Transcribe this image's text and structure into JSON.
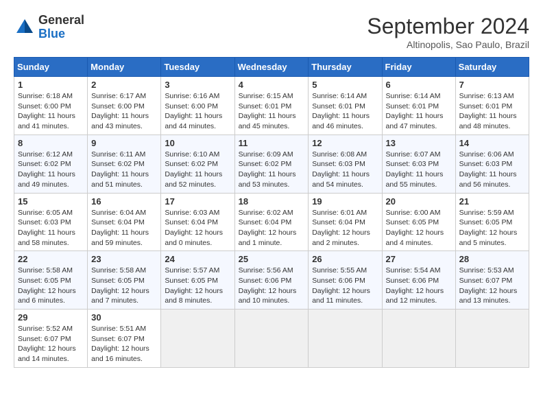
{
  "header": {
    "logo_line1": "General",
    "logo_line2": "Blue",
    "month": "September 2024",
    "location": "Altinopolis, Sao Paulo, Brazil"
  },
  "days_of_week": [
    "Sunday",
    "Monday",
    "Tuesday",
    "Wednesday",
    "Thursday",
    "Friday",
    "Saturday"
  ],
  "weeks": [
    [
      {
        "day": "1",
        "sunrise": "6:18 AM",
        "sunset": "6:00 PM",
        "daylight": "11 hours and 41 minutes."
      },
      {
        "day": "2",
        "sunrise": "6:17 AM",
        "sunset": "6:00 PM",
        "daylight": "11 hours and 43 minutes."
      },
      {
        "day": "3",
        "sunrise": "6:16 AM",
        "sunset": "6:00 PM",
        "daylight": "11 hours and 44 minutes."
      },
      {
        "day": "4",
        "sunrise": "6:15 AM",
        "sunset": "6:01 PM",
        "daylight": "11 hours and 45 minutes."
      },
      {
        "day": "5",
        "sunrise": "6:14 AM",
        "sunset": "6:01 PM",
        "daylight": "11 hours and 46 minutes."
      },
      {
        "day": "6",
        "sunrise": "6:14 AM",
        "sunset": "6:01 PM",
        "daylight": "11 hours and 47 minutes."
      },
      {
        "day": "7",
        "sunrise": "6:13 AM",
        "sunset": "6:01 PM",
        "daylight": "11 hours and 48 minutes."
      }
    ],
    [
      {
        "day": "8",
        "sunrise": "6:12 AM",
        "sunset": "6:02 PM",
        "daylight": "11 hours and 49 minutes."
      },
      {
        "day": "9",
        "sunrise": "6:11 AM",
        "sunset": "6:02 PM",
        "daylight": "11 hours and 51 minutes."
      },
      {
        "day": "10",
        "sunrise": "6:10 AM",
        "sunset": "6:02 PM",
        "daylight": "11 hours and 52 minutes."
      },
      {
        "day": "11",
        "sunrise": "6:09 AM",
        "sunset": "6:02 PM",
        "daylight": "11 hours and 53 minutes."
      },
      {
        "day": "12",
        "sunrise": "6:08 AM",
        "sunset": "6:03 PM",
        "daylight": "11 hours and 54 minutes."
      },
      {
        "day": "13",
        "sunrise": "6:07 AM",
        "sunset": "6:03 PM",
        "daylight": "11 hours and 55 minutes."
      },
      {
        "day": "14",
        "sunrise": "6:06 AM",
        "sunset": "6:03 PM",
        "daylight": "11 hours and 56 minutes."
      }
    ],
    [
      {
        "day": "15",
        "sunrise": "6:05 AM",
        "sunset": "6:03 PM",
        "daylight": "11 hours and 58 minutes."
      },
      {
        "day": "16",
        "sunrise": "6:04 AM",
        "sunset": "6:04 PM",
        "daylight": "11 hours and 59 minutes."
      },
      {
        "day": "17",
        "sunrise": "6:03 AM",
        "sunset": "6:04 PM",
        "daylight": "12 hours and 0 minutes."
      },
      {
        "day": "18",
        "sunrise": "6:02 AM",
        "sunset": "6:04 PM",
        "daylight": "12 hours and 1 minute."
      },
      {
        "day": "19",
        "sunrise": "6:01 AM",
        "sunset": "6:04 PM",
        "daylight": "12 hours and 2 minutes."
      },
      {
        "day": "20",
        "sunrise": "6:00 AM",
        "sunset": "6:05 PM",
        "daylight": "12 hours and 4 minutes."
      },
      {
        "day": "21",
        "sunrise": "5:59 AM",
        "sunset": "6:05 PM",
        "daylight": "12 hours and 5 minutes."
      }
    ],
    [
      {
        "day": "22",
        "sunrise": "5:58 AM",
        "sunset": "6:05 PM",
        "daylight": "12 hours and 6 minutes."
      },
      {
        "day": "23",
        "sunrise": "5:58 AM",
        "sunset": "6:05 PM",
        "daylight": "12 hours and 7 minutes."
      },
      {
        "day": "24",
        "sunrise": "5:57 AM",
        "sunset": "6:05 PM",
        "daylight": "12 hours and 8 minutes."
      },
      {
        "day": "25",
        "sunrise": "5:56 AM",
        "sunset": "6:06 PM",
        "daylight": "12 hours and 10 minutes."
      },
      {
        "day": "26",
        "sunrise": "5:55 AM",
        "sunset": "6:06 PM",
        "daylight": "12 hours and 11 minutes."
      },
      {
        "day": "27",
        "sunrise": "5:54 AM",
        "sunset": "6:06 PM",
        "daylight": "12 hours and 12 minutes."
      },
      {
        "day": "28",
        "sunrise": "5:53 AM",
        "sunset": "6:07 PM",
        "daylight": "12 hours and 13 minutes."
      }
    ],
    [
      {
        "day": "29",
        "sunrise": "5:52 AM",
        "sunset": "6:07 PM",
        "daylight": "12 hours and 14 minutes."
      },
      {
        "day": "30",
        "sunrise": "5:51 AM",
        "sunset": "6:07 PM",
        "daylight": "12 hours and 16 minutes."
      },
      null,
      null,
      null,
      null,
      null
    ]
  ]
}
